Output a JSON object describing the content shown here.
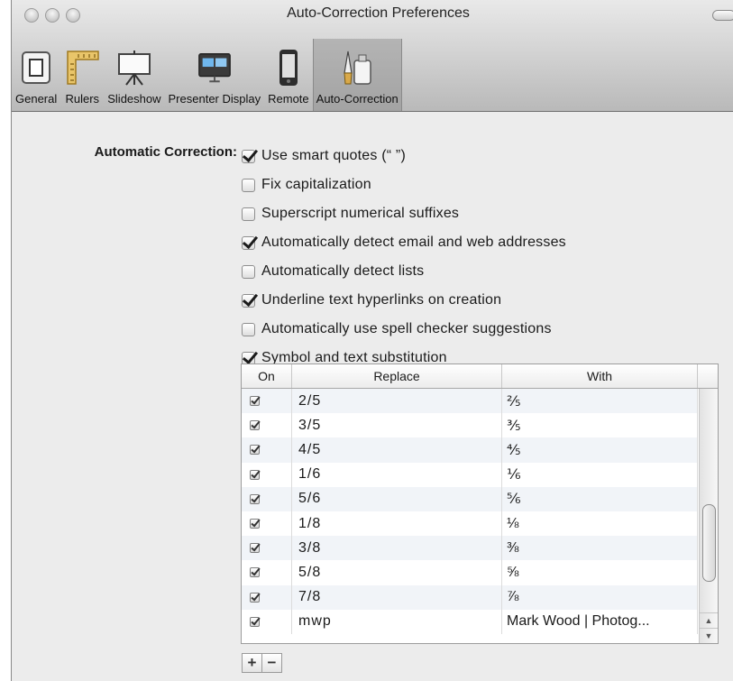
{
  "window": {
    "title": "Auto-Correction Preferences"
  },
  "toolbar": {
    "items": [
      {
        "label": "General",
        "icon": "general-switch-icon"
      },
      {
        "label": "Rulers",
        "icon": "rulers-icon"
      },
      {
        "label": "Slideshow",
        "icon": "slideshow-screen-icon"
      },
      {
        "label": "Presenter Display",
        "icon": "presenter-display-icon"
      },
      {
        "label": "Remote",
        "icon": "iphone-remote-icon"
      },
      {
        "label": "Auto-Correction",
        "icon": "auto-correction-icon"
      }
    ],
    "selected": "Auto-Correction"
  },
  "section": {
    "label": "Automatic Correction:"
  },
  "options": [
    {
      "label": "Use smart quotes (“ ”)",
      "checked": true
    },
    {
      "label": "Fix capitalization",
      "checked": false
    },
    {
      "label": "Superscript numerical suffixes",
      "checked": false
    },
    {
      "label": "Automatically detect email and web addresses",
      "checked": true
    },
    {
      "label": "Automatically detect lists",
      "checked": false
    },
    {
      "label": "Underline text hyperlinks on creation",
      "checked": true
    },
    {
      "label": "Automatically use spell checker suggestions",
      "checked": false
    },
    {
      "label": "Symbol and text substitution",
      "checked": true
    }
  ],
  "table": {
    "headers": {
      "on": "On",
      "replace": "Replace",
      "with": "With"
    },
    "rows": [
      {
        "on": true,
        "replace": "2/5",
        "with": "⅖"
      },
      {
        "on": true,
        "replace": "3/5",
        "with": "⅗"
      },
      {
        "on": true,
        "replace": "4/5",
        "with": "⅘"
      },
      {
        "on": true,
        "replace": "1/6",
        "with": "⅙"
      },
      {
        "on": true,
        "replace": "5/6",
        "with": "⅚"
      },
      {
        "on": true,
        "replace": "1/8",
        "with": "⅛"
      },
      {
        "on": true,
        "replace": "3/8",
        "with": "⅜"
      },
      {
        "on": true,
        "replace": "5/8",
        "with": "⅝"
      },
      {
        "on": true,
        "replace": "7/8",
        "with": "⅞"
      },
      {
        "on": true,
        "replace": "mwp",
        "with": "Mark Wood | Photog..."
      }
    ]
  },
  "buttons": {
    "add": "+",
    "remove": "−"
  }
}
